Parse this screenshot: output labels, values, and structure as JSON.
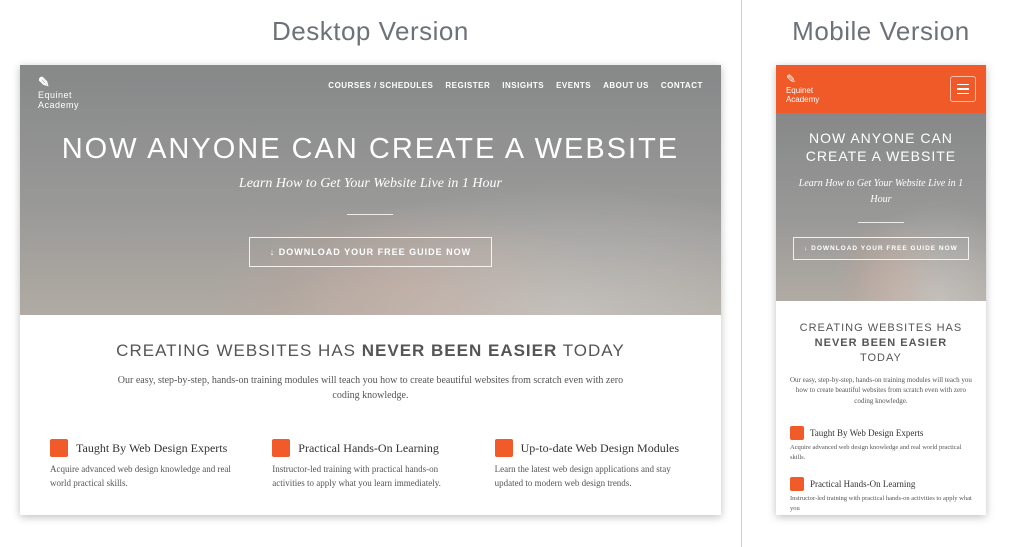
{
  "labels": {
    "desktop_title": "Desktop Version",
    "mobile_title": "Mobile Version"
  },
  "brand": {
    "name_line1": "Equinet",
    "name_line2": "Academy"
  },
  "nav": [
    "COURSES / SCHEDULES",
    "REGISTER",
    "INSIGHTS",
    "EVENTS",
    "ABOUT US",
    "CONTACT"
  ],
  "hero": {
    "title": "NOW ANYONE CAN CREATE A WEBSITE",
    "subtitle": "Learn How to Get Your Website Live in 1 Hour",
    "cta": "↓ DOWNLOAD YOUR FREE GUIDE NOW"
  },
  "section": {
    "heading_pre": "CREATING WEBSITES HAS ",
    "heading_bold": "NEVER BEEN EASIER",
    "heading_post": " TODAY",
    "lead": "Our easy, step-by-step, hands-on training modules will teach you how to create beautiful websites from scratch even with zero coding knowledge."
  },
  "features": [
    {
      "title": "Taught By Web Design Experts",
      "desc": "Acquire advanced web design knowledge and real world practical skills."
    },
    {
      "title": "Practical Hands-On Learning",
      "desc": "Instructor-led training with practical hands-on activities to apply what you learn immediately."
    },
    {
      "title": "Up-to-date Web Design Modules",
      "desc": "Learn the latest web design applications and stay updated to modern web design trends."
    }
  ],
  "mobile_feature_desc_truncated": "Instructor-led training with practical hands-on activities to apply what you",
  "colors": {
    "accent": "#ef5a28"
  }
}
